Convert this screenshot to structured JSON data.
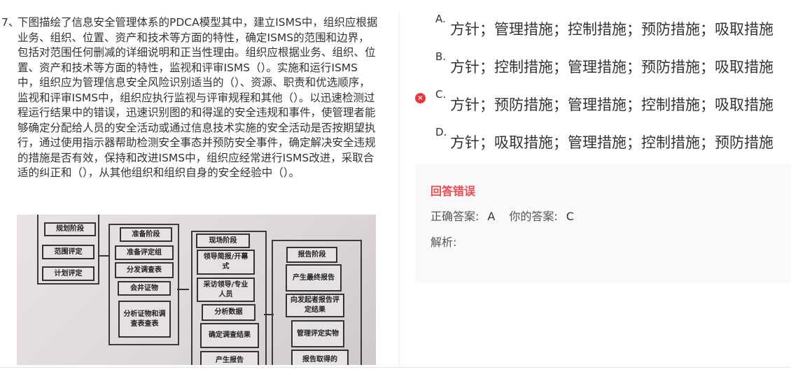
{
  "question": {
    "number": "7、",
    "text": "下图描绘了信息安全管理体系的PDCA模型其中，建立ISMS中，组织应根据业务、组织、位置、资产和技术等方面的特性，确定ISMS的范围和边界，包括对范围任何删减的详细说明和正当性理由。组织应根据业务、组织、位置、资产和技术等方面的特性，监视和评审ISMS（）。实施和运行ISMS中，组织应为管理信息安全风险识别适当的（）、资源、职责和优选顺序，监视和评审ISMS中，组织应执行监视与评审规程和其他（）。以迅速检测过程运行结果中的错误，迅速识别图的和得逞的安全违规和事件，使管理者能够确定分配给人员的安全活动或通过信息技术实施的安全活动是否按期望执行，通过使用指示器帮助检测安全事态并预防安全事件，确定解决安全违规的措施是否有效，保持和改进ISMS中，组织应经常进行ISMS改进，采取合适的纠正和（），从其他组织和组织自身的安全经验中（）。"
  },
  "figure": {
    "columns": [
      {
        "boxes": [
          "规划阶段",
          "范围评定",
          "计划评定"
        ]
      },
      {
        "boxes": [
          "准备阶段",
          "准备评定组",
          "分发调查表",
          "会井证物",
          "分析证物和调查表查表"
        ]
      },
      {
        "boxes": [
          "现场阶段",
          "领导简报/开幕式",
          "采访领导/专业人员",
          "分析数据",
          "确定调查结果",
          "产生报告"
        ]
      },
      {
        "boxes": [
          "报告阶段",
          "产生最终报告",
          "向发起者报告评定结果",
          "管理评定实物",
          "报告取得的"
        ]
      }
    ]
  },
  "options": [
    {
      "letter": "A.",
      "text": "方针；管理措施；控制措施；预防措施；吸取措施"
    },
    {
      "letter": "B.",
      "text": "方针；控制措施；管理措施；预防措施；吸取措施"
    },
    {
      "letter": "C.",
      "text": "方针；预防措施；管理措施；控制措施；吸取措施",
      "selected_wrong": true
    },
    {
      "letter": "D.",
      "text": "方针；吸取措施；管理措施；控制措施；预防措施"
    }
  ],
  "feedback": {
    "status": "回答错误",
    "correct_label": "正确答案:",
    "correct_value": "A",
    "yours_label": "你的答案:",
    "yours_value": "C",
    "analysis_label": "解析:"
  },
  "colors": {
    "error": "#f04a4f",
    "feedback_bg": "#f9f9f9"
  },
  "icons": {
    "wrong": "x-circle-icon"
  }
}
